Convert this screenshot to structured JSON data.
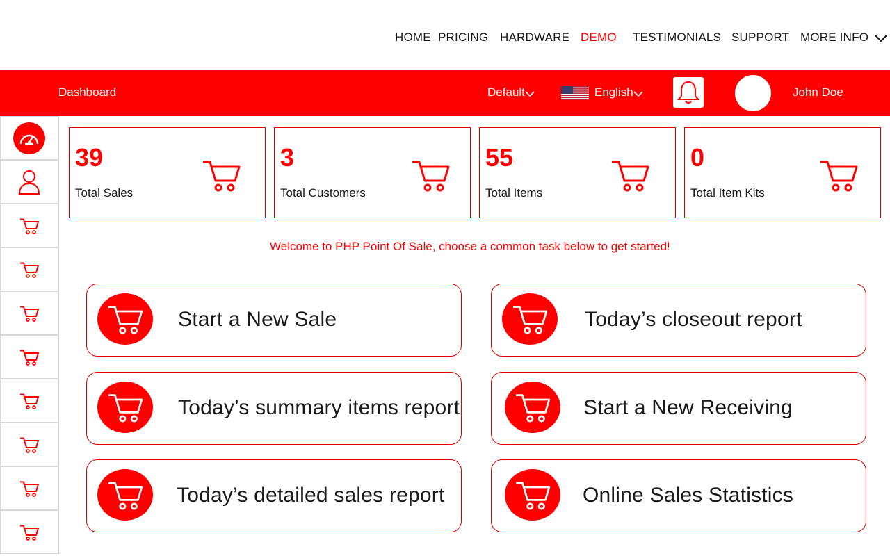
{
  "topnav": {
    "items": [
      "HOME",
      "PRICING",
      "HARDWARE",
      "DEMO",
      "TESTIMONIALS",
      "SUPPORT",
      "MORE INFO"
    ],
    "active": "DEMO"
  },
  "header": {
    "title": "Dashboard",
    "store_select": "Default",
    "language_select": "English",
    "user_name": "John Doe"
  },
  "stats": [
    {
      "value": "39",
      "label": "Total Sales"
    },
    {
      "value": "3",
      "label": "Total Customers"
    },
    {
      "value": "55",
      "label": "Total Items"
    },
    {
      "value": "0",
      "label": "Total Item Kits"
    }
  ],
  "welcome_message": "Welcome to PHP Point Of Sale, choose a common task below to get started!",
  "tasks": [
    "Start a New Sale",
    "Today’s closeout report",
    "Today’s summary items report",
    "Start a New Receiving",
    "Today’s detailed sales report",
    "Online Sales Statistics"
  ],
  "icons": {
    "sidebar": [
      "dashboard-icon",
      "customers-icon",
      "cart-icon",
      "cart-icon",
      "cart-icon",
      "cart-icon",
      "cart-icon",
      "cart-icon",
      "cart-icon",
      "cart-icon"
    ],
    "bell": "bell-icon",
    "flag": "us-flag-icon"
  },
  "colors": {
    "accent": "#ff0000",
    "text": "#1a1a1a"
  }
}
